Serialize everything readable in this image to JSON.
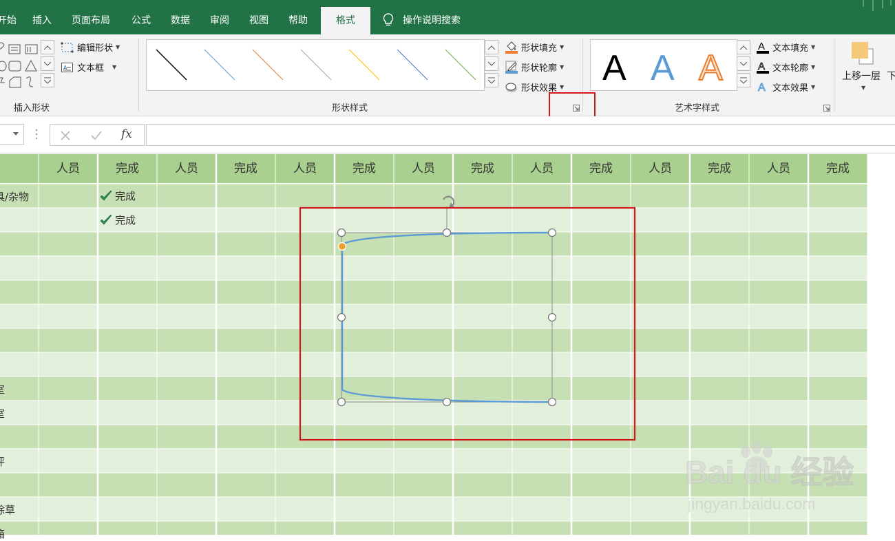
{
  "tabs": [
    "开始",
    "插入",
    "页面布局",
    "公式",
    "数据",
    "审阅",
    "视图",
    "帮助",
    "格式"
  ],
  "tell_me": "操作说明搜索",
  "ribbon": {
    "insert_shapes": {
      "edit_shape": "编辑形状",
      "text_box": "文本框",
      "label": "插入形状"
    },
    "shape_styles": {
      "label": "形状样式",
      "fill": "形状填充",
      "outline": "形状轮廓",
      "effects": "形状效果",
      "line_colors": [
        "#000000",
        "#5b9bd5",
        "#ed7d31",
        "#a5a5a5",
        "#ffc000",
        "#4472c4",
        "#70ad47"
      ]
    },
    "wordart_styles": {
      "label": "艺术字样式",
      "letter": "A",
      "text_fill": "文本填充",
      "text_outline": "文本轮廓",
      "text_effects": "文本效果"
    },
    "arrange": {
      "bring_forward": "上移一层",
      "send_backward": "下"
    }
  },
  "formula_bar": {
    "fx": "fx",
    "value": ""
  },
  "grid": {
    "headers": [
      "人员",
      "完成",
      "人员",
      "完成",
      "人员",
      "完成",
      "人员",
      "完成",
      "人员",
      "完成",
      "人员",
      "完成",
      "人员",
      "完成"
    ],
    "row_labels": [
      "具/杂物",
      "",
      "",
      "",
      "",
      "",
      "",
      "",
      "室",
      "室",
      "",
      "评",
      "",
      "除草",
      "箱"
    ],
    "checks": [
      "完成",
      "完成"
    ]
  },
  "colors": {
    "accent": "#217346",
    "header_fill": "#a9d08e",
    "row_dark": "#c6e0b4",
    "row_light": "#e2efda",
    "highlight_box": "#d0191b",
    "shape_line": "#5b9bd5",
    "adjust_handle": "#f0a030"
  },
  "watermark": {
    "brand": "Bai du 经验",
    "url": "jingyan.baidu.com"
  }
}
